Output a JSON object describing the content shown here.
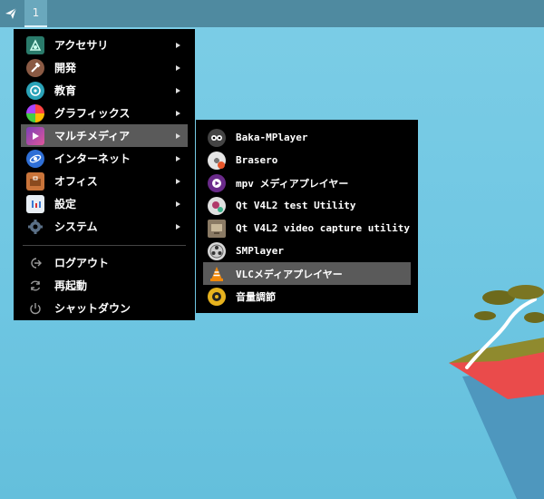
{
  "panel": {
    "workspace": "1"
  },
  "main_menu": {
    "items": [
      {
        "label": "アクセサリ",
        "icon": "accessories-icon"
      },
      {
        "label": "開発",
        "icon": "development-icon"
      },
      {
        "label": "教育",
        "icon": "education-icon"
      },
      {
        "label": "グラフィックス",
        "icon": "graphics-icon"
      },
      {
        "label": "マルチメディア",
        "icon": "multimedia-icon"
      },
      {
        "label": "インターネット",
        "icon": "internet-icon"
      },
      {
        "label": "オフィス",
        "icon": "office-icon"
      },
      {
        "label": "設定",
        "icon": "settings-icon"
      },
      {
        "label": "システム",
        "icon": "system-icon"
      }
    ],
    "session": [
      {
        "label": "ログアウト",
        "icon": "logout-icon"
      },
      {
        "label": "再起動",
        "icon": "restart-icon"
      },
      {
        "label": "シャットダウン",
        "icon": "shutdown-icon"
      }
    ]
  },
  "multimedia_menu": {
    "items": [
      {
        "label": "Baka-MPlayer",
        "icon": "baka-mplayer-icon"
      },
      {
        "label": "Brasero",
        "icon": "brasero-icon"
      },
      {
        "label": "mpv メディアプレイヤー",
        "icon": "mpv-icon"
      },
      {
        "label": "Qt V4L2 test Utility",
        "icon": "qv4l2-icon"
      },
      {
        "label": "Qt V4L2 video capture utility",
        "icon": "qvidcap-icon"
      },
      {
        "label": "SMPlayer",
        "icon": "smplayer-icon"
      },
      {
        "label": "VLCメディアプレイヤー",
        "icon": "vlc-icon"
      },
      {
        "label": "音量調節",
        "icon": "volume-control-icon"
      }
    ]
  }
}
